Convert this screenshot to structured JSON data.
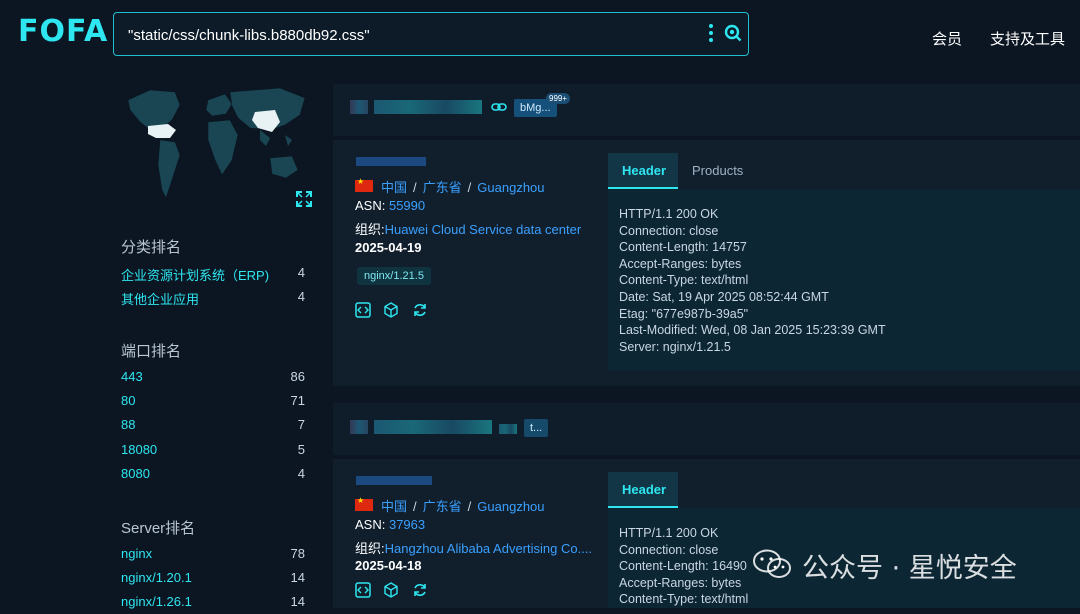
{
  "logo": "FOFA",
  "search": {
    "value": "\"static/css/chunk-libs.b880db92.css\""
  },
  "nav": {
    "member": "会员",
    "tools": "支持及工具"
  },
  "sidebar": {
    "category_title": "分类排名",
    "categories": [
      {
        "label": "企业资源计划系统（ERP)",
        "count": "4"
      },
      {
        "label": "其他企业应用",
        "count": "4"
      }
    ],
    "port_title": "端口排名",
    "ports": [
      {
        "label": "443",
        "count": "86"
      },
      {
        "label": "80",
        "count": "71"
      },
      {
        "label": "88",
        "count": "7"
      },
      {
        "label": "18080",
        "count": "5"
      },
      {
        "label": "8080",
        "count": "4"
      }
    ],
    "server_title": "Server排名",
    "servers": [
      {
        "label": "nginx",
        "count": "78"
      },
      {
        "label": "nginx/1.20.1",
        "count": "14"
      },
      {
        "label": "nginx/1.26.1",
        "count": "14"
      }
    ]
  },
  "results": [
    {
      "tag": "bMg...",
      "badge": "999+",
      "country": "中国",
      "province": "广东省",
      "city": "Guangzhou",
      "asn_label": "ASN:",
      "asn": "55990",
      "org_label": "组织:",
      "org": "Huawei Cloud Service data center",
      "date": "2025-04-19",
      "server_tag": "nginx/1.21.5",
      "tab_header": "Header",
      "tab_products": "Products",
      "header_lines": "HTTP/1.1 200 OK\nConnection: close\nContent-Length: 14757\nAccept-Ranges: bytes\nContent-Type: text/html\nDate: Sat, 19 Apr 2025 08:52:44 GMT\nEtag: \"677e987b-39a5\"\nLast-Modified: Wed, 08 Jan 2025 15:23:39 GMT\nServer: nginx/1.21.5"
    },
    {
      "tag": "t...",
      "country": "中国",
      "province": "广东省",
      "city": "Guangzhou",
      "asn_label": "ASN:",
      "asn": "37963",
      "org_label": "组织:",
      "org": "Hangzhou Alibaba Advertising Co....",
      "date": "2025-04-18",
      "tab_header": "Header",
      "header_lines": "HTTP/1.1 200 OK\nConnection: close\nContent-Length: 16490\nAccept-Ranges: bytes\nContent-Type: text/html"
    }
  ],
  "watermark": "公众号 · 星悦安全",
  "colors": {
    "accent": "#2ee6f0",
    "link": "#3aa0ff",
    "background": "#0b1622"
  }
}
